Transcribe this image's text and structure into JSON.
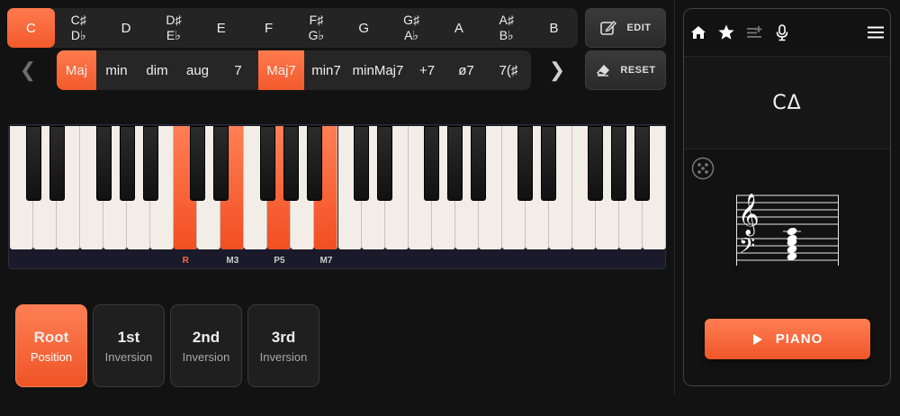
{
  "root_notes": [
    {
      "top": "C",
      "bottom": "",
      "active": true
    },
    {
      "top": "C♯",
      "bottom": "D♭",
      "active": false
    },
    {
      "top": "D",
      "bottom": "",
      "active": false
    },
    {
      "top": "D♯",
      "bottom": "E♭",
      "active": false
    },
    {
      "top": "E",
      "bottom": "",
      "active": false
    },
    {
      "top": "F",
      "bottom": "",
      "active": false
    },
    {
      "top": "F♯",
      "bottom": "G♭",
      "active": false
    },
    {
      "top": "G",
      "bottom": "",
      "active": false
    },
    {
      "top": "G♯",
      "bottom": "A♭",
      "active": false
    },
    {
      "top": "A",
      "bottom": "",
      "active": false
    },
    {
      "top": "A♯",
      "bottom": "B♭",
      "active": false
    },
    {
      "top": "B",
      "bottom": "",
      "active": false
    }
  ],
  "qualities": [
    {
      "label": "Maj",
      "active": true
    },
    {
      "label": "min",
      "active": false
    },
    {
      "label": "dim",
      "active": false
    },
    {
      "label": "aug",
      "active": false
    },
    {
      "label": "7",
      "active": false
    },
    {
      "label": "Maj7",
      "active": true
    },
    {
      "label": "min7",
      "active": false
    },
    {
      "label": "minMaj7",
      "active": false
    },
    {
      "label": "+7",
      "active": false
    },
    {
      "label": "ø7",
      "active": false
    },
    {
      "label": "7(♯",
      "active": false
    }
  ],
  "buttons": {
    "edit": "EDIT",
    "reset": "RESET"
  },
  "keyboard": {
    "white_keys": 28,
    "highlighted_white": [
      7,
      9,
      11,
      13
    ],
    "interval_labels": [
      {
        "label": "R",
        "white_index": 7,
        "root": true
      },
      {
        "label": "M3",
        "white_index": 9,
        "root": false
      },
      {
        "label": "P5",
        "white_index": 11,
        "root": false
      },
      {
        "label": "M7",
        "white_index": 13,
        "root": false
      }
    ]
  },
  "inversions": [
    {
      "title": "Root",
      "subtitle": "Position",
      "active": true
    },
    {
      "title": "1st",
      "subtitle": "Inversion",
      "active": false
    },
    {
      "title": "2nd",
      "subtitle": "Inversion",
      "active": false
    },
    {
      "title": "3rd",
      "subtitle": "Inversion",
      "active": false
    }
  ],
  "panel": {
    "chord_symbol": "CΔ",
    "play_label": "PIANO",
    "icons": [
      "home-icon",
      "star-icon",
      "playlist-icon",
      "microphone-icon",
      "menu-icon",
      "dice-icon",
      "play-icon"
    ]
  },
  "colors": {
    "accent": "#f76235",
    "background": "#121212"
  }
}
